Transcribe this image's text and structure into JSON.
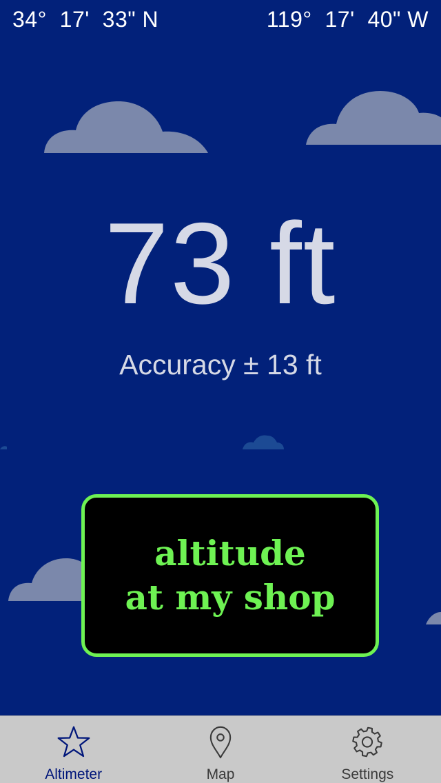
{
  "status": {
    "latitude": "34°  17'  33\" N",
    "longitude": "119°  17'  40\" W"
  },
  "reading": {
    "altitude": "73 ft",
    "accuracy": "Accuracy ± 13 ft"
  },
  "callout": {
    "line1": "altitude",
    "line2": "at my shop"
  },
  "tabbar": {
    "tabs": [
      {
        "label": "Altimeter",
        "icon": "star-icon",
        "selected": true
      },
      {
        "label": "Map",
        "icon": "map-pin-icon",
        "selected": false
      },
      {
        "label": "Settings",
        "icon": "gear-icon",
        "selected": false
      }
    ]
  },
  "colors": {
    "sky": "#02217a",
    "cloud": "#7b88ab",
    "cloud_distant": "#1c4a94",
    "text": "#ffffff",
    "reading_text": "#d6d9e6",
    "callout_border": "#6ef253",
    "callout_text": "#6ef253",
    "tabbar_bg": "#c9c9c9",
    "tab_selected": "#00167a",
    "tab_unselected": "#3a3a3a"
  }
}
